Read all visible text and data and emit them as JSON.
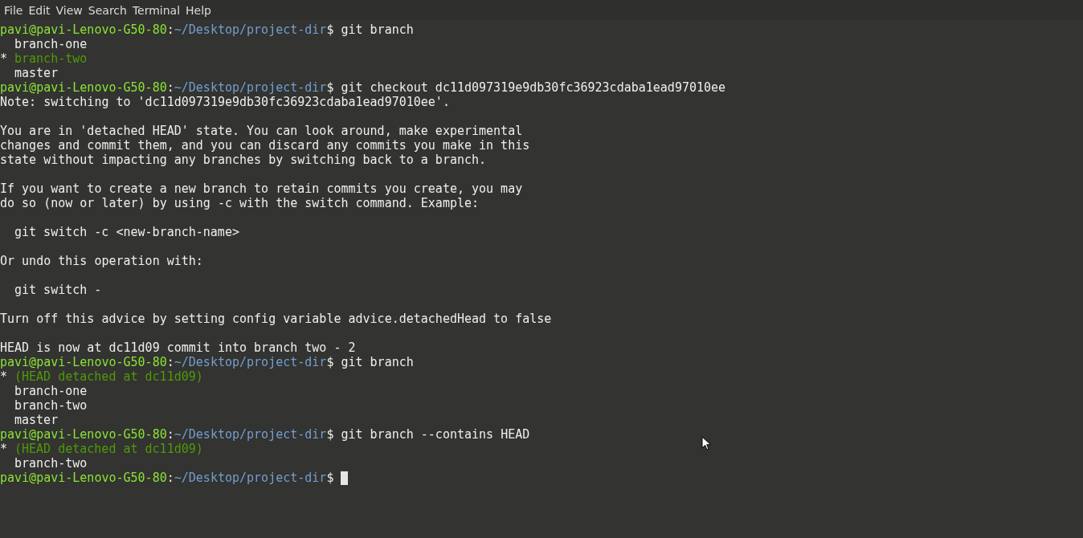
{
  "menu": [
    "File",
    "Edit",
    "View",
    "Search",
    "Terminal",
    "Help"
  ],
  "lines": [
    {
      "kind": "prompt",
      "user": "pavi@pavi-Lenovo-G50-80",
      "separator": ":",
      "path": "~/Desktop/project-dir",
      "command": "$ git branch"
    },
    {
      "kind": "branch",
      "current": false,
      "name": "branch-one"
    },
    {
      "kind": "branch",
      "current": true,
      "marker": "*",
      "name": "branch-two"
    },
    {
      "kind": "branch",
      "current": false,
      "name": "master"
    },
    {
      "kind": "prompt",
      "user": "pavi@pavi-Lenovo-G50-80",
      "separator": ":",
      "path": "~/Desktop/project-dir",
      "command": "$ git checkout dc11d097319e9db30fc36923cdaba1ead97010ee"
    },
    {
      "kind": "output",
      "text": "Note: switching to 'dc11d097319e9db30fc36923cdaba1ead97010ee'."
    },
    {
      "kind": "blank"
    },
    {
      "kind": "output",
      "text": "You are in 'detached HEAD' state. You can look around, make experimental"
    },
    {
      "kind": "output",
      "text": "changes and commit them, and you can discard any commits you make in this"
    },
    {
      "kind": "output",
      "text": "state without impacting any branches by switching back to a branch."
    },
    {
      "kind": "blank"
    },
    {
      "kind": "output",
      "text": "If you want to create a new branch to retain commits you create, you may"
    },
    {
      "kind": "output",
      "text": "do so (now or later) by using -c with the switch command. Example:"
    },
    {
      "kind": "blank"
    },
    {
      "kind": "code",
      "text": "git switch -c <new-branch-name>"
    },
    {
      "kind": "blank"
    },
    {
      "kind": "output",
      "text": "Or undo this operation with:"
    },
    {
      "kind": "blank"
    },
    {
      "kind": "code",
      "text": "git switch -"
    },
    {
      "kind": "blank"
    },
    {
      "kind": "output",
      "text": "Turn off this advice by setting config variable advice.detachedHead to false"
    },
    {
      "kind": "blank"
    },
    {
      "kind": "output",
      "text": "HEAD is now at dc11d09 commit into branch two - 2"
    },
    {
      "kind": "prompt",
      "user": "pavi@pavi-Lenovo-G50-80",
      "separator": ":",
      "path": "~/Desktop/project-dir",
      "command": "$ git branch"
    },
    {
      "kind": "branch",
      "current": true,
      "marker": "*",
      "name": "(HEAD detached at dc11d09)"
    },
    {
      "kind": "branch",
      "current": false,
      "name": "branch-one"
    },
    {
      "kind": "branch",
      "current": false,
      "name": "branch-two"
    },
    {
      "kind": "branch",
      "current": false,
      "name": "master"
    },
    {
      "kind": "prompt",
      "user": "pavi@pavi-Lenovo-G50-80",
      "separator": ":",
      "path": "~/Desktop/project-dir",
      "command": "$ git branch --contains HEAD"
    },
    {
      "kind": "branch",
      "current": true,
      "marker": "*",
      "name": "(HEAD detached at dc11d09)"
    },
    {
      "kind": "branch",
      "current": false,
      "name": "branch-two"
    },
    {
      "kind": "prompt",
      "user": "pavi@pavi-Lenovo-G50-80",
      "separator": ":",
      "path": "~/Desktop/project-dir",
      "command": "$",
      "cursor": true
    }
  ]
}
